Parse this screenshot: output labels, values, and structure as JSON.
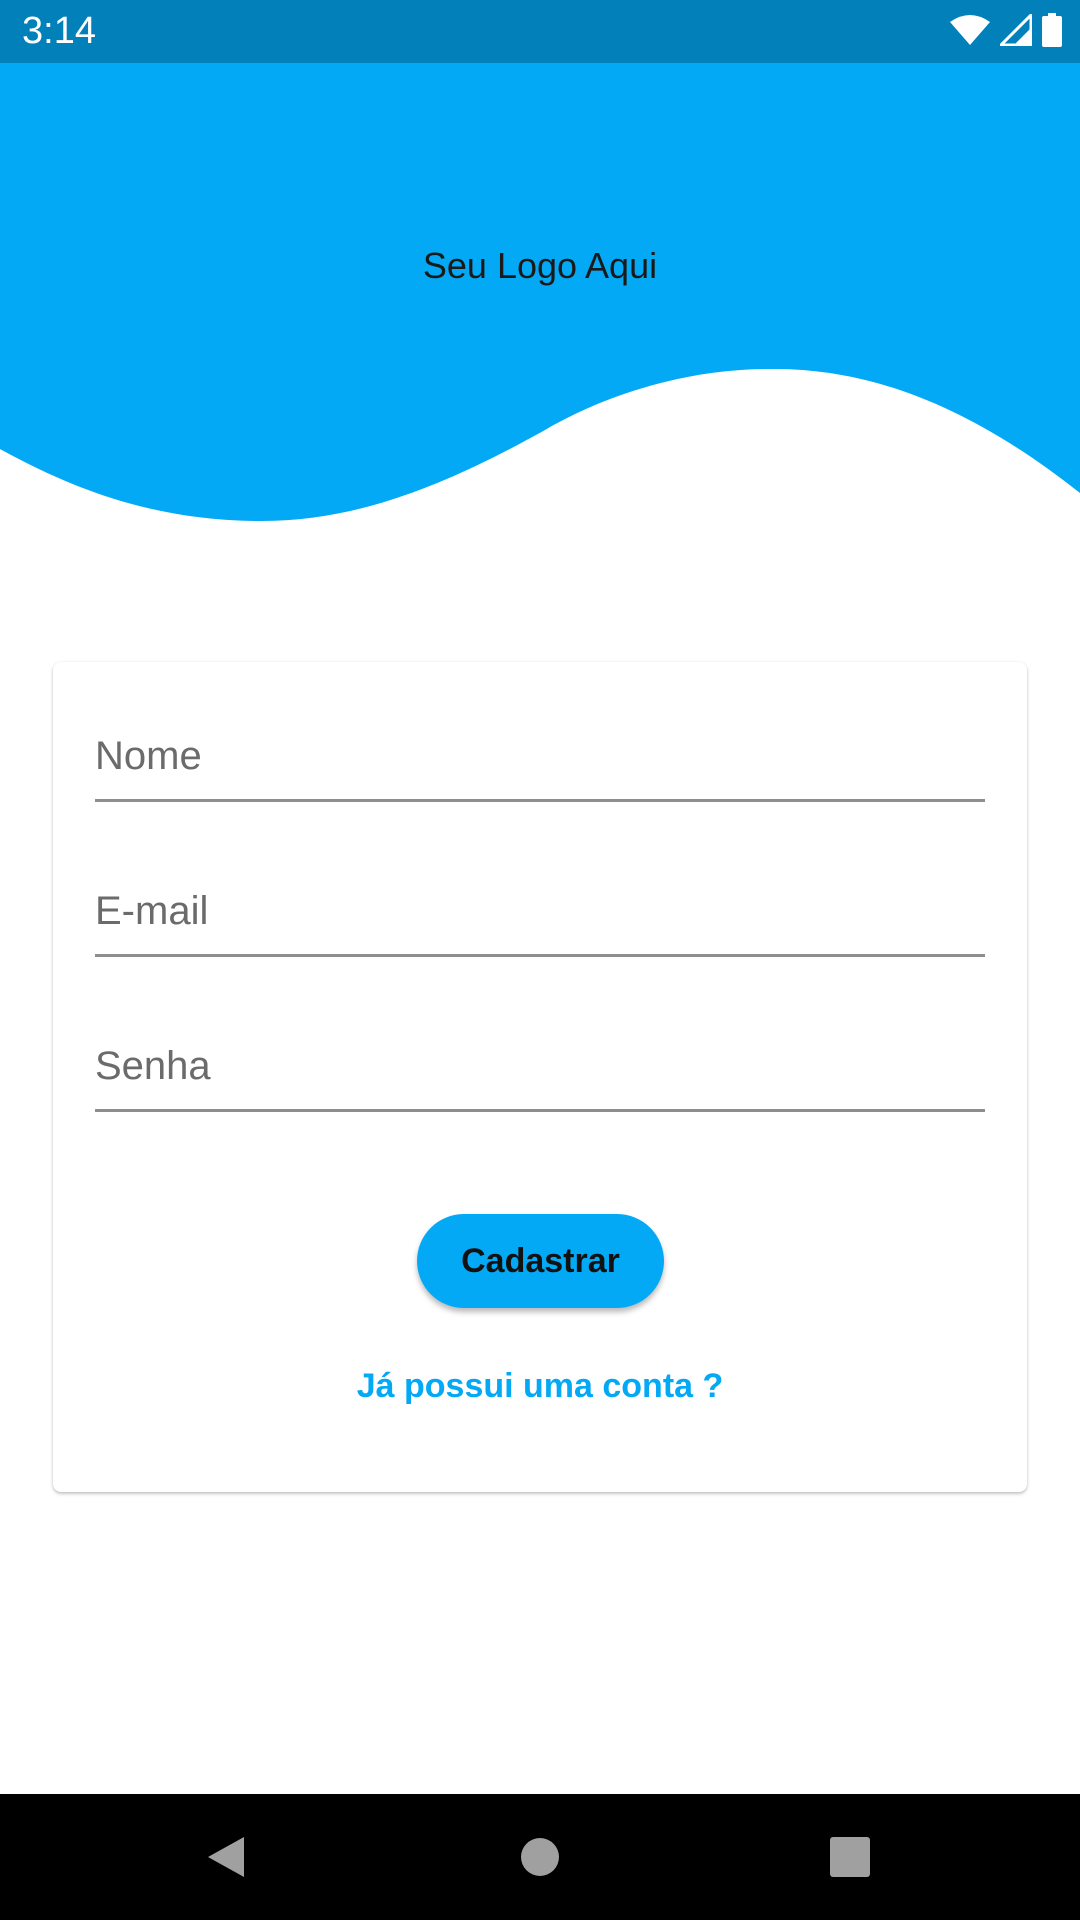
{
  "status_bar": {
    "time": "3:14",
    "icons": [
      "wifi-icon",
      "cell-signal-icon",
      "battery-icon"
    ],
    "background": "#0180BA"
  },
  "header": {
    "logo_text": "Seu Logo Aqui",
    "background": "#03A9F4"
  },
  "form": {
    "fields": {
      "name": {
        "value": "",
        "placeholder": "Nome"
      },
      "email": {
        "value": "",
        "placeholder": "E-mail"
      },
      "password": {
        "value": "",
        "placeholder": "Senha"
      }
    },
    "submit_label": "Cadastrar",
    "login_link": "Já possui uma conta ?"
  },
  "nav_bar": {
    "buttons": [
      "back-icon",
      "home-icon",
      "recents-icon"
    ]
  },
  "colors": {
    "accent": "#03A9F4",
    "status_bar": "#0180BA",
    "nav_bar": "#000000"
  }
}
